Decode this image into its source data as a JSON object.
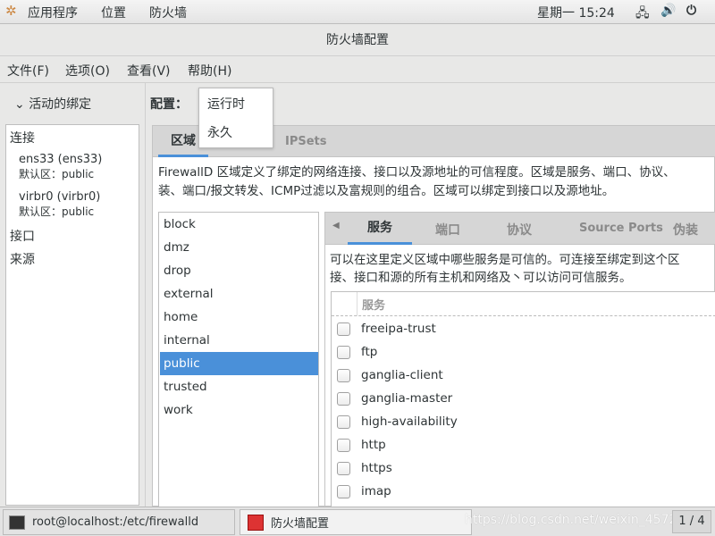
{
  "topbar": {
    "apps": "应用程序",
    "places": "位置",
    "app_name": "防火墙",
    "clock": "星期一 15:24"
  },
  "window": {
    "title": "防火墙配置"
  },
  "menu": [
    "文件(F)",
    "选项(O)",
    "查看(V)",
    "帮助(H)"
  ],
  "left": {
    "header": "活动的绑定",
    "connections_label": "连接",
    "connections": [
      {
        "name": "ens33 (ens33)",
        "zone_label": "默认区：",
        "zone": "public"
      },
      {
        "name": "virbr0 (virbr0)",
        "zone_label": "默认区：",
        "zone": "public"
      }
    ],
    "interfaces_label": "接口",
    "sources_label": "来源"
  },
  "config": {
    "label": "配置：",
    "options": [
      "运行时",
      "永久"
    ]
  },
  "tabs": [
    "区域",
    "IPSets"
  ],
  "zone_description": [
    "FirewallD 区域定义了绑定的网络连接、接口以及源地址的可信程度。区域是服务、端口、协议、",
    "装、端口/报文转发、ICMP过滤以及富规则的组合。区域可以绑定到接口以及源地址。"
  ],
  "zones": [
    "block",
    "dmz",
    "drop",
    "external",
    "home",
    "internal",
    "public",
    "trusted",
    "work"
  ],
  "selected_zone": "public",
  "subtabs": [
    "服务",
    "端口",
    "协议",
    "Source Ports",
    "伪装"
  ],
  "services_description": [
    "可以在这里定义区域中哪些服务是可信的。可连接至绑定到这个区",
    "接、接口和源的所有主机和网络及丶可以访问可信服务。"
  ],
  "services_header": "服务",
  "services": [
    {
      "name": "freeipa-trust",
      "checked": false
    },
    {
      "name": "ftp",
      "checked": false
    },
    {
      "name": "ganglia-client",
      "checked": false
    },
    {
      "name": "ganglia-master",
      "checked": false
    },
    {
      "name": "high-availability",
      "checked": false
    },
    {
      "name": "http",
      "checked": false
    },
    {
      "name": "https",
      "checked": false
    },
    {
      "name": "imap",
      "checked": false
    }
  ],
  "taskbar": {
    "items": [
      "root@localhost:/etc/firewalld",
      "防火墙配置"
    ],
    "watermark": "https://blog.csdn.net/weixin_4572",
    "pager": "1 / 4"
  },
  "colors": {
    "selection": "#4a90d9",
    "accent_underline": "#4a90d9"
  }
}
